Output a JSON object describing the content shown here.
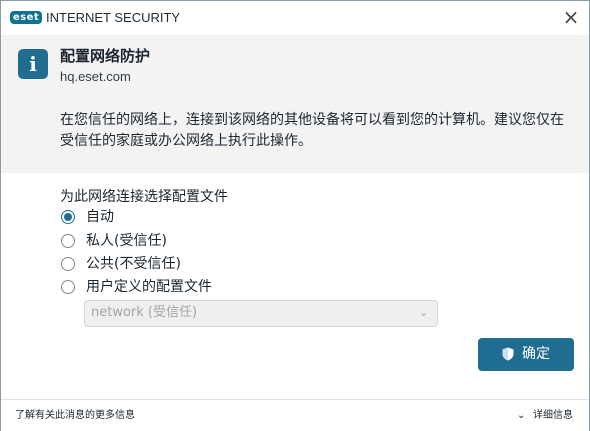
{
  "window": {
    "logo_text": "eset",
    "app_title": "INTERNET SECURITY",
    "close_glyph": "×"
  },
  "header": {
    "icon": "info-icon",
    "icon_glyph": "i",
    "title": "配置网络防护",
    "network_name": "hq.eset.com",
    "description": "在您信任的网络上，连接到该网络的其他设备将可以看到您的计算机。建议您仅在受信任的家庭或办公网络上执行此操作。"
  },
  "profile": {
    "label": "为此网络连接选择配置文件",
    "options": [
      {
        "label": "自动",
        "checked": true
      },
      {
        "label": "私人(受信任)",
        "checked": false
      },
      {
        "label": "公共(不受信任)",
        "checked": false
      },
      {
        "label": "用户定义的配置文件",
        "checked": false
      }
    ],
    "dropdown": {
      "value": "network (受信任)",
      "disabled": true,
      "chevron": "⌄"
    }
  },
  "actions": {
    "ok_label": "确定",
    "ok_icon": "shield-icon"
  },
  "footer": {
    "link_text": "了解有关此消息的更多信息",
    "details_label": "详细信息",
    "details_chevron": "⌄"
  },
  "colors": {
    "accent": "#1f6e92",
    "header_bg": "#f3f3f4",
    "logo": "#0f7290",
    "disabled_text": "#a2a6aa"
  }
}
